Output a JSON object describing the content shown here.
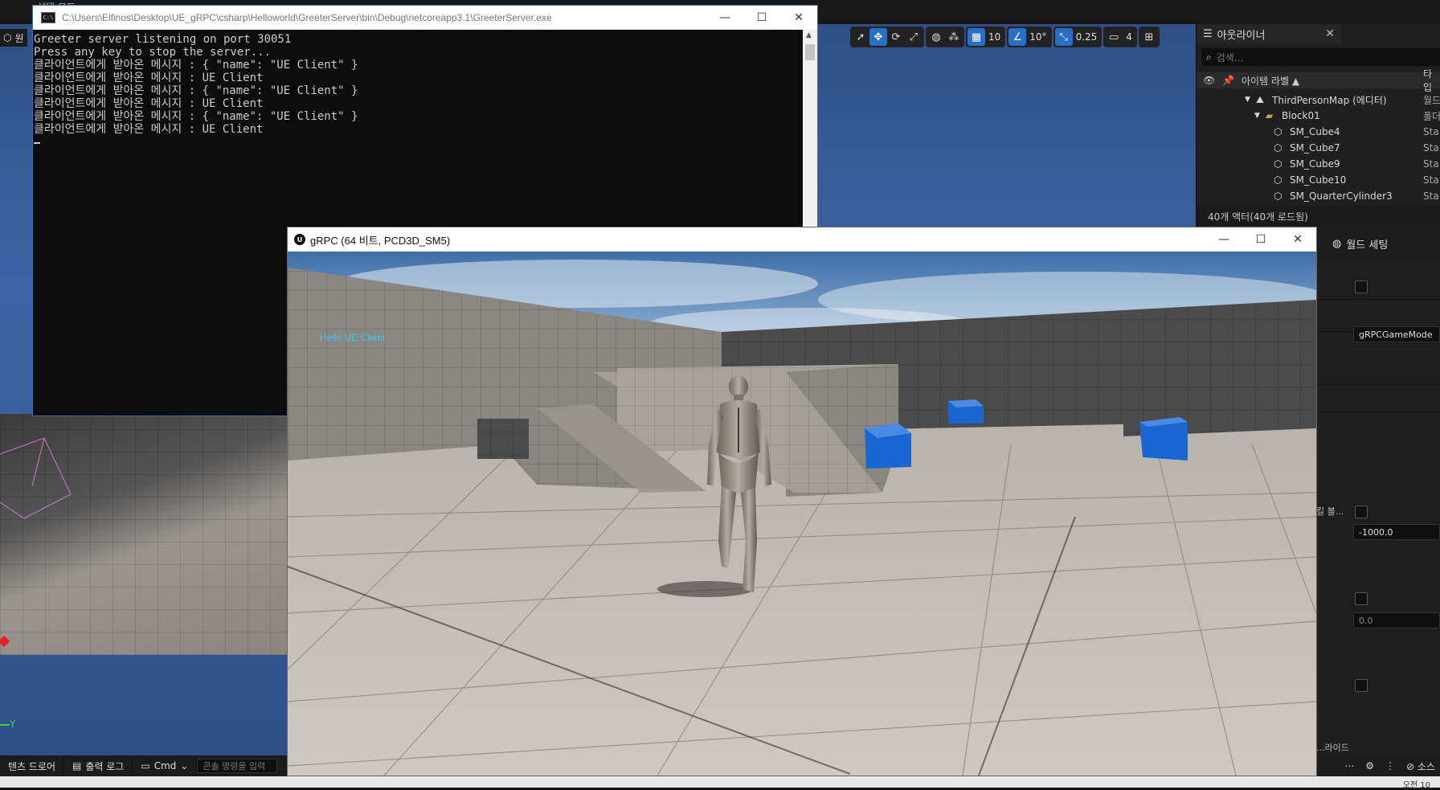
{
  "editor": {
    "mode_tab": "원",
    "top_menu": "선택 모드",
    "viewport_toolbar": {
      "grid_snap": "10",
      "angle_snap": "10°",
      "scale_snap": "0.25",
      "camera_speed": "4"
    },
    "axis_label": "Y"
  },
  "outliner": {
    "title": "아웃라이너",
    "search_placeholder": "검색...",
    "header_label": "아이템 라벨 ▲",
    "header_type": "타입",
    "items": [
      {
        "label": "ThirdPersonMap (에디터)",
        "type": "월드"
      },
      {
        "label": "Block01",
        "type": "폴더"
      },
      {
        "label": "SM_Cube4",
        "type": "Sta"
      },
      {
        "label": "SM_Cube7",
        "type": "Sta"
      },
      {
        "label": "SM_Cube9",
        "type": "Sta"
      },
      {
        "label": "SM_Cube10",
        "type": "Sta"
      },
      {
        "label": "SM_QuarterCylinder3",
        "type": "Sta"
      }
    ],
    "footer": "40개 액터(40개 로드됨)"
  },
  "details": {
    "tab_label": "월드 세팅",
    "game_mode_value": "gRPCGameMode",
    "z_kill_value": "-1000.0",
    "value_zero": "0.0",
    "partial_label": "킬 볼...",
    "partial_label_2": "...라이드"
  },
  "bottombar": {
    "content_drawer": "텐츠 드로어",
    "output_log": "출력 로그",
    "cmd": "Cmd",
    "console_placeholder": "콘솔 명령을 입력",
    "source": "소스"
  },
  "taskbar": {
    "clock": "오전 10"
  },
  "console": {
    "title": "C:\\Users\\Elfinos\\Desktop\\UE_gRPC\\csharp\\Helloworld\\GreeterServer\\bin\\Debug\\netcoreapp3.1\\GreeterServer.exe",
    "icon_text": "C:\\",
    "lines": [
      "Greeter server listening on port 30051",
      "Press any key to stop the server...",
      "클라이언트에게 받아온 메시지 : { \"name\": \"UE Client\" }",
      "클라이언트에게 받아온 메시지 : UE Client",
      "클라이언트에게 받아온 메시지 : { \"name\": \"UE Client\" }",
      "클라이언트에게 받아온 메시지 : UE Client",
      "클라이언트에게 받아온 메시지 : { \"name\": \"UE Client\" }",
      "클라이언트에게 받아온 메시지 : UE Client"
    ]
  },
  "game": {
    "title": "gRPC (64 비트, PCD3D_SM5)",
    "logo_text": "U",
    "hud_text": "Hello UE Client"
  },
  "colors": {
    "ue_selection_blue": "#2a6fc6",
    "hud_cyan": "#3cc8f0",
    "console_bg": "#0c0c0c",
    "cube_blue": "#1a66d0"
  }
}
